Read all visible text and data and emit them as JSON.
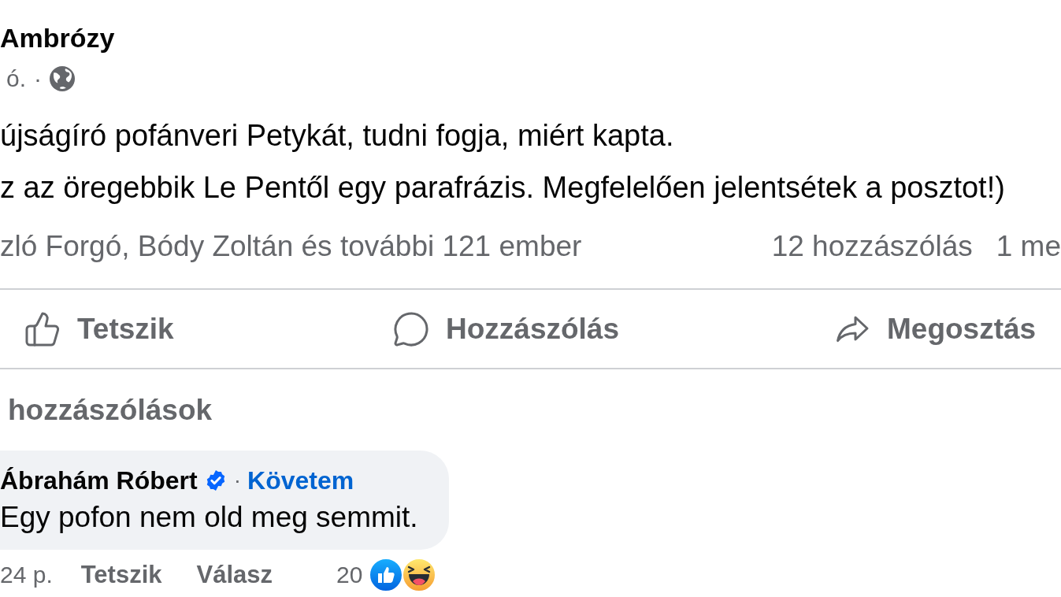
{
  "post": {
    "author": "Ambrózy",
    "time": "ó.",
    "separator": "·",
    "paragraphs": [
      "újságíró pofánveri Petykát, tudni fogja, miért kapta.",
      "z az öregebbik Le Pentől egy parafrázis. Megfelelően jelentsétek a posztot!)"
    ],
    "reactions_summary": "zló Forgó, Bódy Zoltán és további 121 ember",
    "stats": [
      "12 hozzászólás",
      "1 me"
    ],
    "actions": [
      {
        "kind": "like",
        "label": "Tetszik"
      },
      {
        "kind": "comment",
        "label": "Hozzászólás"
      },
      {
        "kind": "share",
        "label": "Megosztás"
      }
    ]
  },
  "comments_heading": "hozzászólások",
  "comments": [
    {
      "author": "Ábrahám Róbert",
      "verified": true,
      "separator": "·",
      "follow": "Követem",
      "text": "Egy pofon nem old meg semmit.",
      "time": "24 p.",
      "actions": [
        "Tetszik",
        "Válasz"
      ],
      "reaction_count": "20"
    }
  ]
}
